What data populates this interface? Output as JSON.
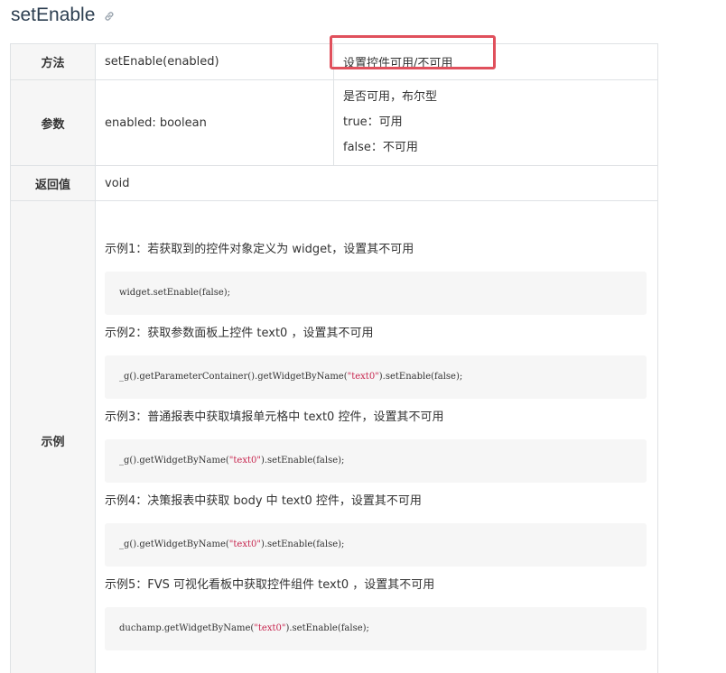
{
  "heading": {
    "title": "setEnable",
    "anchor_icon": "link-icon"
  },
  "table": {
    "method": {
      "label": "方法",
      "signature": "setEnable(enabled)",
      "description": "设置控件可用/不可用"
    },
    "params": {
      "label": "参数",
      "value": "enabled: boolean",
      "lines": [
        "是否可用，布尔型",
        "true：可用",
        "false：不可用"
      ]
    },
    "return": {
      "label": "返回值",
      "value": "void"
    },
    "examples": {
      "label": "示例",
      "items": [
        {
          "title": "示例1：若获取到的控件对象定义为 widget，设置其不可用",
          "code_pre": "widget.setEnable(false);",
          "code_str": "",
          "code_post": ""
        },
        {
          "title": "示例2：获取参数面板上控件 text0 ，设置其不可用",
          "code_pre": "_g().getParameterContainer().getWidgetByName(",
          "code_str": "\"text0\"",
          "code_post": ").setEnable(false);"
        },
        {
          "title": "示例3：普通报表中获取填报单元格中 text0 控件，设置其不可用",
          "code_pre": "_g().getWidgetByName(",
          "code_str": "\"text0\"",
          "code_post": ").setEnable(false);"
        },
        {
          "title": "示例4：决策报表中获取 body 中 text0 控件，设置其不可用",
          "code_pre": "_g().getWidgetByName(",
          "code_str": "\"text0\"",
          "code_post": ").setEnable(false);"
        },
        {
          "title": "示例5：FVS 可视化看板中获取控件组件 text0 ，设置其不可用",
          "code_pre": "duchamp.getWidgetByName(",
          "code_str": "\"text0\"",
          "code_post": ").setEnable(false);"
        }
      ]
    }
  },
  "colors": {
    "highlight_border": "#e0505c",
    "code_bg": "#f6f6f6",
    "string_color": "#c7254e"
  }
}
